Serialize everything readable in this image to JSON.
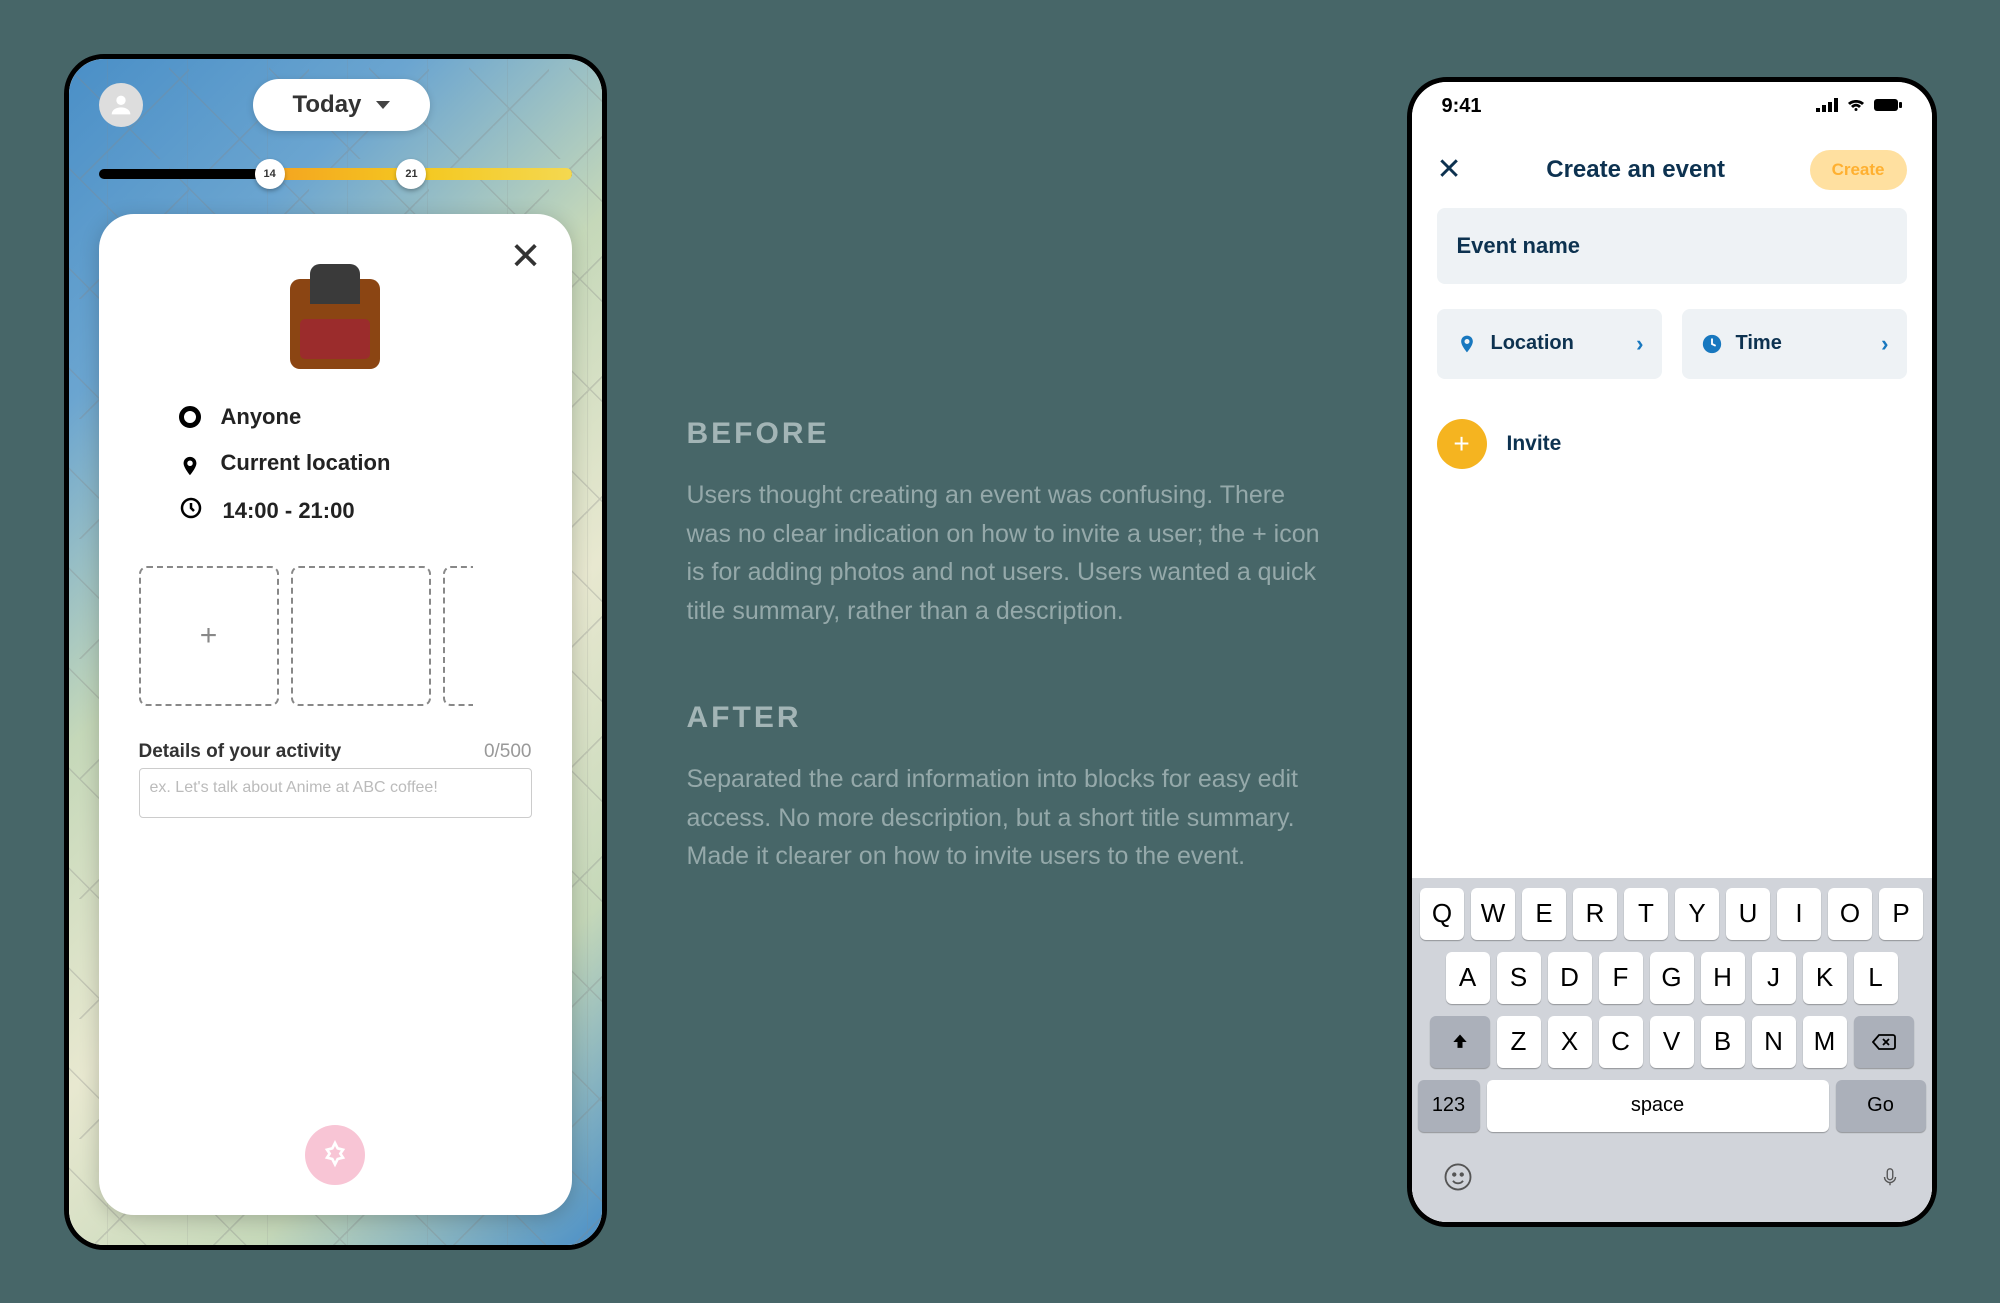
{
  "before": {
    "header": {
      "today_label": "Today",
      "slider_start": "14",
      "slider_end": "21"
    },
    "card": {
      "anyone": "Anyone",
      "location": "Current location",
      "time": "14:00 - 21:00",
      "details_label": "Details of your activity",
      "details_count": "0/500",
      "details_placeholder": "ex. Let's talk about Anime at ABC coffee!",
      "add_icon": "+"
    }
  },
  "copy": {
    "before_title": "BEFORE",
    "before_body": "Users thought creating an event was confusing. There was no clear indication on how to invite a user; the + icon is for adding photos and not users. Users wanted a quick title summary, rather than a description.",
    "after_title": "AFTER",
    "after_body": "Separated the card information into blocks for easy edit access. No more description, but a short title summary. Made it clearer on how to invite users to the event."
  },
  "after": {
    "status_time": "9:41",
    "header_title": "Create an event",
    "create_button": "Create",
    "name_placeholder": "Event name",
    "location_label": "Location",
    "time_label": "Time",
    "invite_label": "Invite",
    "keyboard": {
      "row1": [
        "Q",
        "W",
        "E",
        "R",
        "T",
        "Y",
        "U",
        "I",
        "O",
        "P"
      ],
      "row2": [
        "A",
        "S",
        "D",
        "F",
        "G",
        "H",
        "J",
        "K",
        "L"
      ],
      "row3": [
        "Z",
        "X",
        "C",
        "V",
        "B",
        "N",
        "M"
      ],
      "key_123": "123",
      "key_space": "space",
      "key_go": "Go"
    }
  }
}
